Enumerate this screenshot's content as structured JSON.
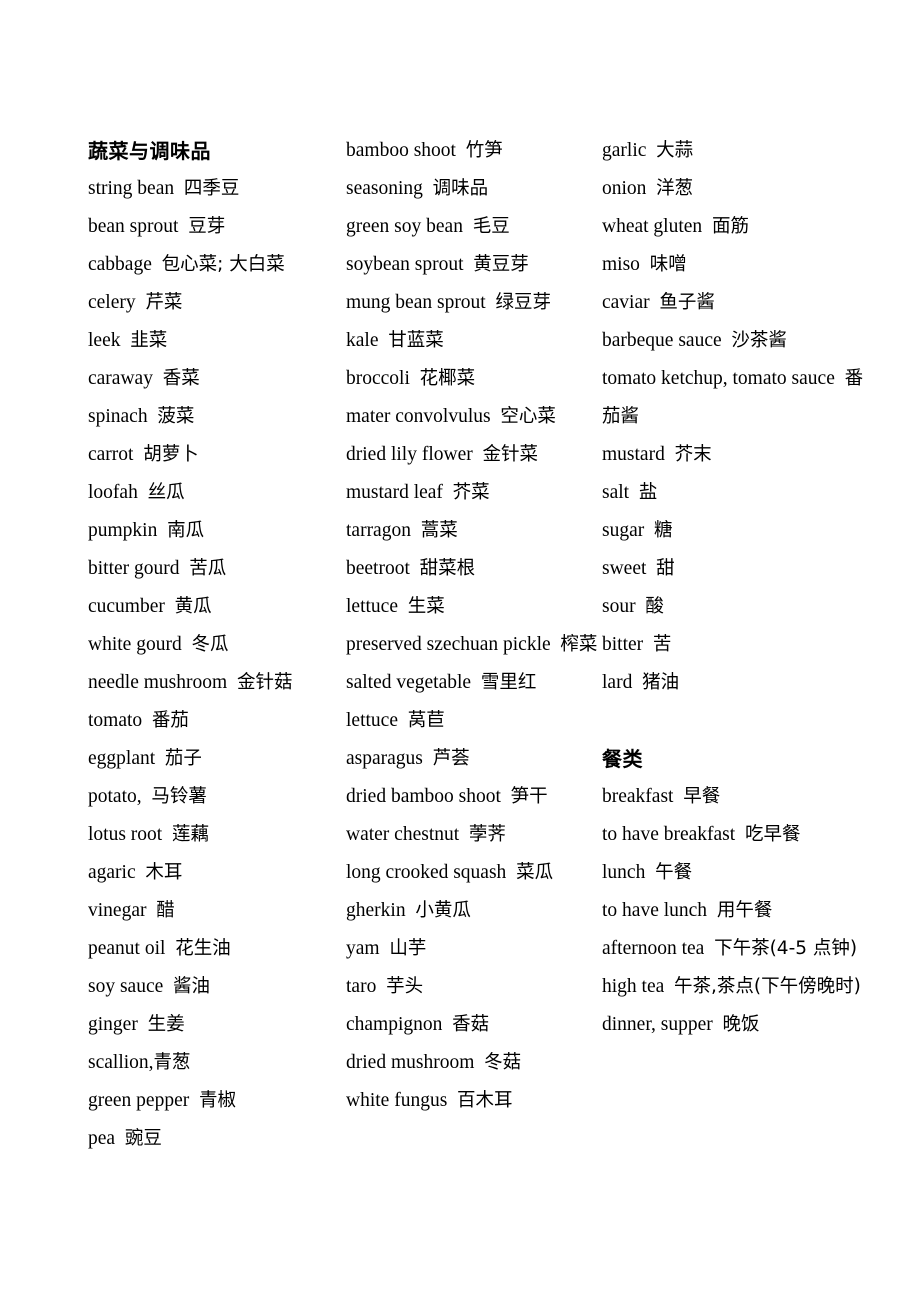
{
  "document": {
    "type": "glossary",
    "language_pair": "English-Chinese",
    "column_count": 3
  },
  "columns": [
    {
      "id": "column-1",
      "blocks": [
        {
          "kind": "heading",
          "text": "蔬菜与调味品"
        },
        {
          "kind": "entry",
          "en": "string bean",
          "zh": "四季豆"
        },
        {
          "kind": "entry",
          "en": "bean sprout",
          "zh": "豆芽"
        },
        {
          "kind": "entry",
          "en": "cabbage",
          "zh": "包心菜; 大白菜"
        },
        {
          "kind": "entry",
          "en": "celery",
          "zh": "芹菜"
        },
        {
          "kind": "entry",
          "en": "leek",
          "zh": "韭菜"
        },
        {
          "kind": "entry",
          "en": "caraway",
          "zh": "香菜"
        },
        {
          "kind": "entry",
          "en": "spinach",
          "zh": "菠菜"
        },
        {
          "kind": "entry",
          "en": "carrot",
          "zh": "胡萝卜"
        },
        {
          "kind": "entry",
          "en": "loofah",
          "zh": "丝瓜"
        },
        {
          "kind": "entry",
          "en": "pumpkin",
          "zh": "南瓜"
        },
        {
          "kind": "entry",
          "en": "bitter gourd",
          "zh": "苦瓜"
        },
        {
          "kind": "entry",
          "en": "cucumber",
          "zh": "黄瓜"
        },
        {
          "kind": "entry",
          "en": "white gourd",
          "zh": "冬瓜"
        },
        {
          "kind": "entry",
          "en": "needle mushroom",
          "zh": "金针菇"
        },
        {
          "kind": "entry",
          "en": "tomato",
          "zh": "番茄"
        },
        {
          "kind": "entry",
          "en": "eggplant",
          "zh": "茄子"
        },
        {
          "kind": "entry",
          "en": "potato,",
          "zh": "马铃薯"
        },
        {
          "kind": "entry",
          "en": "lotus root",
          "zh": "莲藕"
        },
        {
          "kind": "entry",
          "en": "agaric",
          "zh": "木耳"
        },
        {
          "kind": "entry",
          "en": "vinegar",
          "zh": "醋"
        },
        {
          "kind": "entry",
          "en": "peanut oil",
          "zh": "花生油"
        },
        {
          "kind": "entry",
          "en": "soy sauce",
          "zh": "酱油"
        },
        {
          "kind": "entry",
          "en": "ginger",
          "zh": "生姜"
        },
        {
          "kind": "entry",
          "en": "scallion,",
          "zh": "青葱",
          "nospace": true
        },
        {
          "kind": "entry",
          "en": "green pepper",
          "zh": "青椒"
        },
        {
          "kind": "entry",
          "en": "pea",
          "zh": "豌豆"
        }
      ]
    },
    {
      "id": "column-2",
      "blocks": [
        {
          "kind": "entry",
          "en": "bamboo shoot",
          "zh": "竹笋"
        },
        {
          "kind": "entry",
          "en": "seasoning",
          "zh": "调味品"
        },
        {
          "kind": "entry",
          "en": "green soy bean",
          "zh": "毛豆"
        },
        {
          "kind": "entry",
          "en": "soybean sprout",
          "zh": "黄豆芽"
        },
        {
          "kind": "entry",
          "en": "mung bean sprout",
          "zh": "绿豆芽"
        },
        {
          "kind": "entry",
          "en": "kale",
          "zh": "甘蓝菜"
        },
        {
          "kind": "entry",
          "en": "broccoli",
          "zh": "花椰菜"
        },
        {
          "kind": "entry",
          "en": "mater convolvulus",
          "zh": "空心菜"
        },
        {
          "kind": "entry",
          "en": "dried lily flower",
          "zh": "金针菜"
        },
        {
          "kind": "entry",
          "en": "mustard leaf",
          "zh": "芥菜"
        },
        {
          "kind": "entry",
          "en": "tarragon",
          "zh": "蒿菜"
        },
        {
          "kind": "entry",
          "en": "beetroot",
          "zh": "甜菜根"
        },
        {
          "kind": "entry",
          "en": "lettuce",
          "zh": "生菜"
        },
        {
          "kind": "entry",
          "en": "preserved szechuan pickle",
          "zh": "榨菜"
        },
        {
          "kind": "entry",
          "en": "salted vegetable",
          "zh": "雪里红"
        },
        {
          "kind": "entry",
          "en": "lettuce",
          "zh": "莴苣"
        },
        {
          "kind": "entry",
          "en": "asparagus",
          "zh": "芦荟"
        },
        {
          "kind": "entry",
          "en": "dried bamboo shoot",
          "zh": "笋干"
        },
        {
          "kind": "entry",
          "en": "water chestnut",
          "zh": "荸荠"
        },
        {
          "kind": "entry",
          "en": "long crooked squash",
          "zh": "菜瓜"
        },
        {
          "kind": "entry",
          "en": "gherkin",
          "zh": "小黄瓜"
        },
        {
          "kind": "entry",
          "en": "yam",
          "zh": "山芋"
        },
        {
          "kind": "entry",
          "en": "taro",
          "zh": "芋头"
        },
        {
          "kind": "entry",
          "en": "champignon",
          "zh": "香菇"
        },
        {
          "kind": "entry",
          "en": "dried mushroom",
          "zh": "冬菇"
        },
        {
          "kind": "entry",
          "en": "white fungus",
          "zh": "百木耳"
        }
      ]
    },
    {
      "id": "column-3",
      "blocks": [
        {
          "kind": "entry",
          "en": "garlic",
          "zh": "大蒜"
        },
        {
          "kind": "entry",
          "en": "onion",
          "zh": "洋葱"
        },
        {
          "kind": "entry",
          "en": "wheat gluten",
          "zh": "面筋"
        },
        {
          "kind": "entry",
          "en": "miso",
          "zh": "味噌"
        },
        {
          "kind": "entry",
          "en": "caviar",
          "zh": "鱼子酱"
        },
        {
          "kind": "entry",
          "en": "barbeque sauce",
          "zh": "沙茶酱"
        },
        {
          "kind": "entry",
          "en": "tomato ketchup, tomato sauce",
          "zh": "番茄酱"
        },
        {
          "kind": "entry",
          "en": "mustard",
          "zh": "芥末"
        },
        {
          "kind": "entry",
          "en": "salt",
          "zh": "盐"
        },
        {
          "kind": "entry",
          "en": "sugar",
          "zh": "糖"
        },
        {
          "kind": "entry",
          "en": "sweet",
          "zh": "甜"
        },
        {
          "kind": "entry",
          "en": "sour",
          "zh": "酸"
        },
        {
          "kind": "entry",
          "en": "bitter",
          "zh": "苦"
        },
        {
          "kind": "entry",
          "en": "lard",
          "zh": "猪油"
        },
        {
          "kind": "spacer"
        },
        {
          "kind": "heading",
          "text": "餐类"
        },
        {
          "kind": "entry",
          "en": "breakfast",
          "zh": "早餐"
        },
        {
          "kind": "entry",
          "en": "to have breakfast",
          "zh": "吃早餐"
        },
        {
          "kind": "entry",
          "en": "lunch",
          "zh": "午餐"
        },
        {
          "kind": "entry",
          "en": "to have lunch",
          "zh": "用午餐"
        },
        {
          "kind": "entry",
          "en": "afternoon tea",
          "zh": "下午茶(4-5 点钟)"
        },
        {
          "kind": "entry",
          "en": "high tea",
          "zh": "午茶,茶点(下午傍晚时)"
        },
        {
          "kind": "entry",
          "en": "dinner, supper",
          "zh": "晚饭"
        }
      ]
    }
  ]
}
